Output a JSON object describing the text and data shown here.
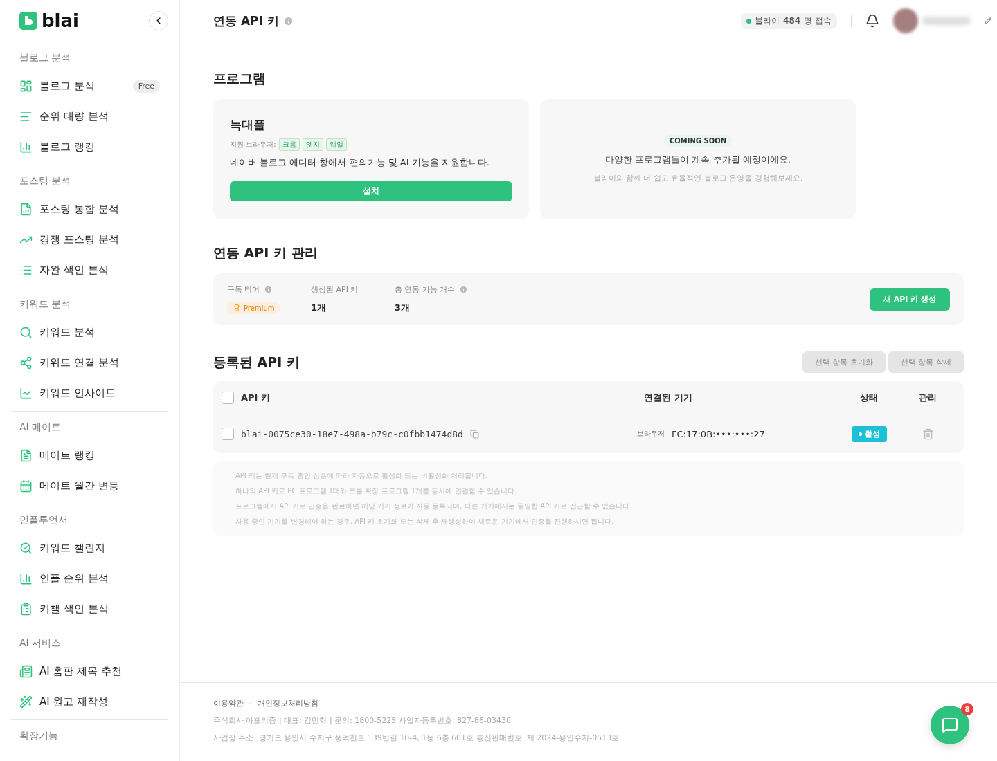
{
  "logo": {
    "text": "blai"
  },
  "sidebar": {
    "groups": [
      {
        "title": "블로그 분석",
        "items": [
          {
            "label": "블로그 분석",
            "badge": "Free"
          },
          {
            "label": "순위 대량 분석"
          },
          {
            "label": "블로그 랭킹"
          }
        ]
      },
      {
        "title": "포스팅 분석",
        "items": [
          {
            "label": "포스팅 통합 분석"
          },
          {
            "label": "경쟁 포스팅 분석"
          },
          {
            "label": "자완 색인 분석"
          }
        ]
      },
      {
        "title": "키워드 분석",
        "items": [
          {
            "label": "키워드 분석"
          },
          {
            "label": "키워드 연결 분석"
          },
          {
            "label": "키워드 인사이트"
          }
        ]
      },
      {
        "title": "AI 메이트",
        "items": [
          {
            "label": "메이트 랭킹"
          },
          {
            "label": "메이트 월간 변동"
          }
        ]
      },
      {
        "title": "인플루언서",
        "items": [
          {
            "label": "키워드 챌린지"
          },
          {
            "label": "인플 순위 분석"
          },
          {
            "label": "키챌 색인 분석"
          }
        ]
      },
      {
        "title": "AI 서비스",
        "items": [
          {
            "label": "AI 홈판 제목 추천"
          },
          {
            "label": "AI 원고 재작성"
          }
        ]
      },
      {
        "title": "확장기능"
      }
    ]
  },
  "header": {
    "title": "연동 API 키",
    "online": {
      "prefix": "블라이 ",
      "count": "484",
      "suffix": "명 접속"
    }
  },
  "programs": {
    "title": "프로그램",
    "card": {
      "name": "늑대플",
      "browsers_label": "지원 브라우저:",
      "browsers": [
        "크롬",
        "엣지",
        "웨일"
      ],
      "description": "네이버 블로그 에디터 창에서 편의기능 및 AI 기능을 지원합니다.",
      "button": "설치"
    },
    "coming": {
      "badge": "COMING SOON",
      "title": "다양한 프로그램들이 계속 추가될 예정이에요.",
      "subtitle": "블라이와 함께 더 쉽고 효율적인 블로그 운영을 경험해보세요."
    }
  },
  "management": {
    "title": "연동 API 키 관리",
    "stats": [
      {
        "label": "구독 티어",
        "info": true,
        "tier": "Premium"
      },
      {
        "label": "생성된 API 키",
        "info": false,
        "value": "1개"
      },
      {
        "label": "총 연동 가능 개수",
        "info": true,
        "value": "3개"
      }
    ],
    "button": "새 API 키 생성"
  },
  "registered": {
    "title": "등록된 API 키",
    "actions": [
      {
        "label": "선택 항목 초기화",
        "disabled": true
      },
      {
        "label": "선택 항목 삭제",
        "disabled": true
      }
    ],
    "columns": [
      "API 키",
      "연결된 기기",
      "상태",
      "관리"
    ],
    "header_checked": false,
    "rows": [
      {
        "checked": false,
        "key": "blai-0075ce30-18e7-498a-b79c-c0fbb1474d8d",
        "device_type": "브라우저",
        "device": "FC:17:0B:•••:•••:27",
        "status": "활성",
        "active": true
      }
    ]
  },
  "notes": [
    "API 키는 현재 구독 중인 상품에 따라 자동으로 활성화 또는 비활성화 처리됩니다.",
    "하나의 API 키로 PC 프로그램 1대와 크롬 확장 프로그램 1개를 동시에 연결할 수 있습니다.",
    "프로그램에서 API 키로 인증을 완료하면 해당 기기 정보가 자동 등록되며, 다른 기기에서는 동일한 API 키로 접근할 수 없습니다.",
    "사용 중인 기기를 변경해야 하는 경우, API 키 초기화 또는 삭제 후 재생성하여 새로운 기기에서 인증을 진행하시면 됩니다."
  ],
  "footer": {
    "links": [
      "이용약관",
      "개인정보처리방침"
    ],
    "separator": "·",
    "lines": [
      "주식회사 아포리즘 | 대표: 김민혁 | 문의: 1800-5225 사업자등록번호: 827-86-03430",
      "사업장 주소: 경기도 용인시 수지구 풍덕천로 139번길 10-4, 1동 6층 601호 통신판매번호: 제 2024-용인수지-0513호"
    ]
  },
  "chat": {
    "badge": "8"
  }
}
